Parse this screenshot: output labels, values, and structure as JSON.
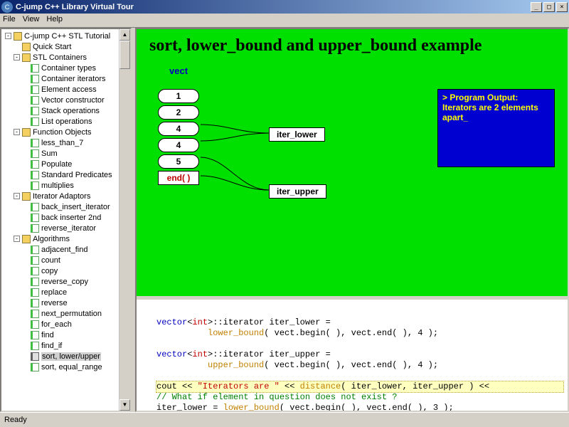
{
  "window": {
    "title": "C-jump C++ Library Virtual Tour",
    "icon_glyph": "C"
  },
  "menubar": [
    "File",
    "View",
    "Help"
  ],
  "tree": {
    "root": "C-jump C++ STL Tutorial",
    "quick_start": "Quick Start",
    "groups": [
      {
        "label": "STL Containers",
        "items": [
          "Container types",
          "Container iterators",
          "Element access",
          "Vector constructor",
          "Stack operations",
          "List operations"
        ]
      },
      {
        "label": "Function Objects",
        "items": [
          "less_than_7",
          "Sum",
          "Populate",
          "Standard Predicates",
          "multiplies"
        ]
      },
      {
        "label": "Iterator Adaptors",
        "items": [
          "back_insert_iterator",
          "back inserter 2nd",
          "reverse_iterator"
        ]
      },
      {
        "label": "Algorithms",
        "items": [
          "adjacent_find",
          "count",
          "copy",
          "reverse_copy",
          "replace",
          "reverse",
          "next_permutation",
          "for_each",
          "find",
          "find_if",
          "sort, lower/upper",
          "sort, equal_range"
        ]
      }
    ],
    "selected": "sort, lower/upper"
  },
  "diagram": {
    "title": "sort, lower_bound and upper_bound example",
    "vect_label": "vect",
    "cells": [
      "1",
      "2",
      "4",
      "4",
      "5"
    ],
    "end_label": "end( )",
    "iter_lower": "iter_lower",
    "iter_upper": "iter_upper",
    "output_title": "> Program Output:",
    "output_body": "Iterators are 2 elements apart_"
  },
  "code": {
    "lines": [
      {
        "t": "",
        "h": false
      },
      {
        "t": "vector<int>::iterator iter_lower =",
        "h": false,
        "parts": [
          [
            "vector",
            "kw"
          ],
          [
            "<",
            ""
          ],
          [
            "int",
            "ty"
          ],
          [
            ">::iterator iter_lower =",
            ""
          ]
        ]
      },
      {
        "t": "          lower_bound( vect.begin( ), vect.end( ), 4 );",
        "h": false,
        "parts": [
          [
            "          ",
            ""
          ],
          [
            "lower_bound",
            "fn"
          ],
          [
            "( vect.begin( ), vect.end( ), 4 );",
            ""
          ]
        ]
      },
      {
        "t": "",
        "h": false
      },
      {
        "t": "vector<int>::iterator iter_upper =",
        "h": false,
        "parts": [
          [
            "vector",
            "kw"
          ],
          [
            "<",
            ""
          ],
          [
            "int",
            "ty"
          ],
          [
            ">::iterator iter_upper =",
            ""
          ]
        ]
      },
      {
        "t": "          upper_bound( vect.begin( ), vect.end( ), 4 );",
        "h": false,
        "parts": [
          [
            "          ",
            ""
          ],
          [
            "upper_bound",
            "fn"
          ],
          [
            "( vect.begin( ), vect.end( ), 4 );",
            ""
          ]
        ]
      },
      {
        "t": "",
        "h": false
      },
      {
        "t": "cout << \"Iterators are \" << distance( iter_lower, iter_upper ) <<",
        "h": true,
        "parts": [
          [
            "cout << ",
            ""
          ],
          [
            "\"Iterators are \"",
            "ty"
          ],
          [
            " << ",
            ""
          ],
          [
            "distance",
            "fn"
          ],
          [
            "( iter_lower, iter_upper )",
            ""
          ],
          [
            " <<",
            ""
          ]
        ]
      },
      {
        "t": "// What if element in question does not exist ?",
        "h": false,
        "parts": [
          [
            "// What if element in question does not exist ?",
            "cm"
          ]
        ]
      },
      {
        "t": "iter_lower = lower_bound( vect.begin( ), vect.end( ), 3 );",
        "h": false,
        "parts": [
          [
            "iter_lower = ",
            ""
          ],
          [
            "lower_bound",
            "fn"
          ],
          [
            "( vect.begin( ), vect.end( ), 3 );",
            ""
          ]
        ]
      }
    ]
  },
  "statusbar": "Ready"
}
